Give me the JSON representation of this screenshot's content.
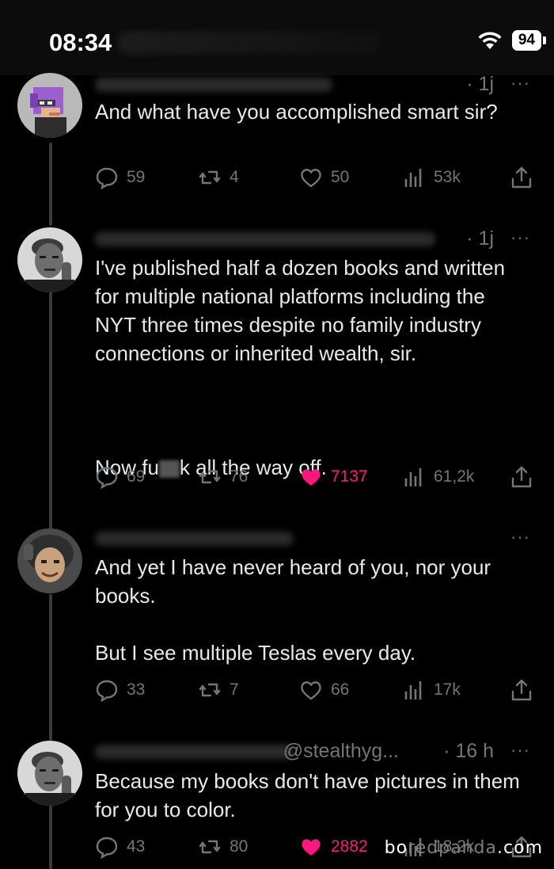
{
  "status_bar": {
    "time": "08:34",
    "battery": "94"
  },
  "tweets": [
    {
      "meta_time": "· 1j",
      "body": "And what have you accomplished smart sir?",
      "replies": "59",
      "reposts": "4",
      "likes": "50",
      "views": "53k",
      "liked": false
    },
    {
      "meta_time": "· 1j",
      "body_part1": "I've published half a dozen books and written for multiple national platforms including the NYT three times despite no family industry connections or inherited wealth, sir.",
      "body_part2_a": "Now fu",
      "body_part2_b": "k all the way off.",
      "replies": "69",
      "reposts": "76",
      "likes": "7137",
      "views": "61,2k",
      "liked": true
    },
    {
      "body": "And yet I have never heard of you, nor your books.\n\nBut I see multiple Teslas every day.",
      "replies": "33",
      "reposts": "7",
      "likes": "66",
      "views": "17k",
      "liked": false
    },
    {
      "handle": "@stealthyg...",
      "meta_time": "· 16 h",
      "body": "Because my books don't have pictures in them for you to color.",
      "replies": "43",
      "reposts": "80",
      "likes": "2882",
      "views": "18,2k",
      "liked": true
    }
  ],
  "more_label": "···",
  "watermark": {
    "a": "bo",
    "b": "redpanda",
    "c": ".com"
  },
  "colors": {
    "background": "#000000",
    "text": "#e7e9ea",
    "muted": "#71767b",
    "like_active": "#f91880"
  }
}
